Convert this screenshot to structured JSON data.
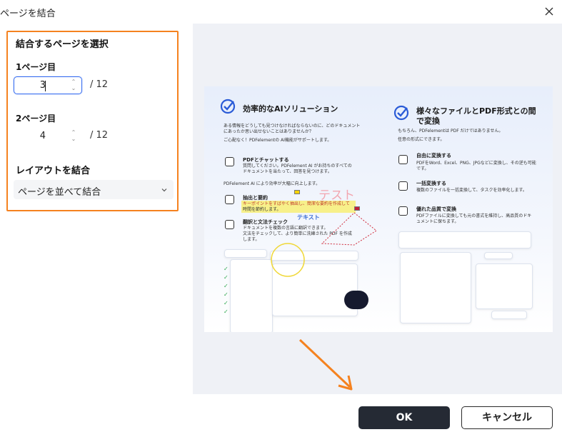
{
  "window": {
    "title": "ページを結合"
  },
  "left_panel": {
    "section_title": "結合するページを選択",
    "page1": {
      "label": "1ページ目",
      "value": "3",
      "total": "/  12"
    },
    "page2": {
      "label": "2ページ目",
      "value": "4",
      "total": "/  12"
    },
    "layout": {
      "label": "レイアウトを結合",
      "selected": "ページを並べて結合"
    }
  },
  "preview": {
    "left_column": {
      "heading": "効率的なAIソリューション",
      "intro_1": "ある情報をどうしても見つけなければならないのに、どのドキュメント",
      "intro_2": "にあったか思い出せないことはありませんか？",
      "intro_3": "ご心配なく！PDFelementの AI機能がサポートします。",
      "feature_1_title": "PDFとチャットする",
      "feature_1_text_1": "質問してください。PDFelement AI がお持ちのすべての",
      "feature_1_text_2": "ドキュメントを当たって、回答を見つけます。",
      "lead_2": "PDFelement AI により効率が大幅に向上します。",
      "feature_2_title": "抽出と要約",
      "feature_2_text_1": "キーポイントをすばやく抽出し、簡潔な要約を作成して",
      "feature_2_text_2": "時間を節約します。",
      "feature_3_title": "翻訳と文法チェック",
      "feature_3_text_1": "ドキュメントを複数の言語に翻訳できます。",
      "feature_3_text_2": "文法をチェックして、より簡単に洗練された PDF を作成",
      "feature_3_text_3": "します。",
      "annot_test_1": "テスト",
      "annot_test_2": "テキスト"
    },
    "right_column": {
      "heading_1": "様々なファイルとPDF形式との間",
      "heading_2": "で変換",
      "intro_1": "もちろん、PDFelementは PDF だけではありません。",
      "intro_2": "任意の形式にできます。",
      "feature_1_title": "自由に変換する",
      "feature_1_text_1": "PDFをWord、Excel、PNG、JPGなどに変換し、その逆も可能",
      "feature_1_text_2": "です。",
      "feature_2_title": "一括変換する",
      "feature_2_text": "複数のファイルを一括変換して、タスクを効率化します。",
      "feature_3_title": "優れた品質で変換",
      "feature_3_text_1": "PDFファイルに変換しても元の書式を維持し、高品質のドキ",
      "feature_3_text_2": "ュメントに保ちます。"
    }
  },
  "buttons": {
    "ok": "OK",
    "cancel": "キャンセル"
  },
  "colors": {
    "highlight_border": "#f5821f",
    "focus_border": "#3a6ff0",
    "ok_bg": "#252a34",
    "preview_bg": "#eff1f6"
  }
}
